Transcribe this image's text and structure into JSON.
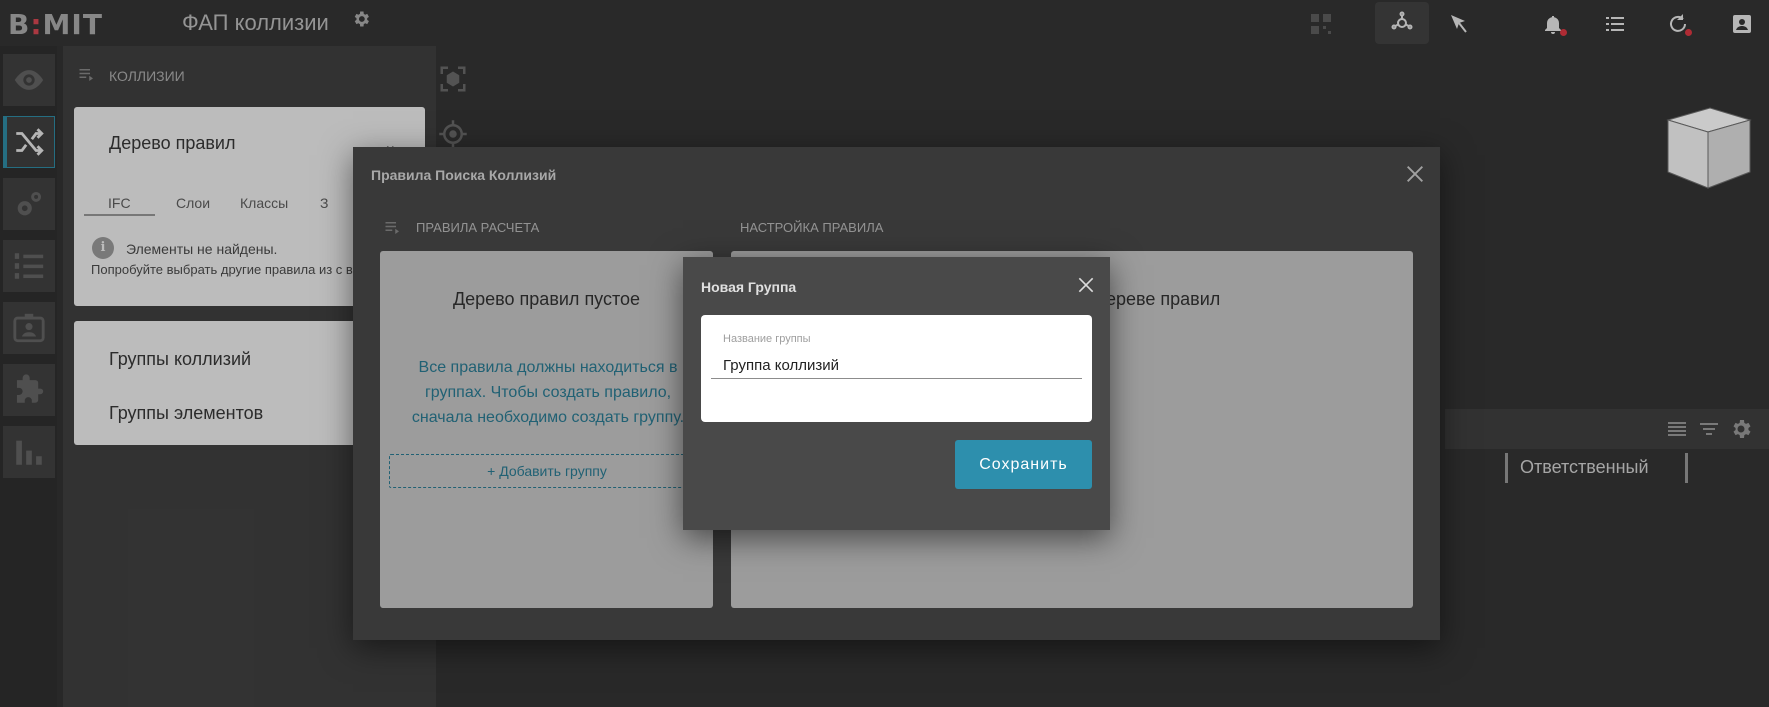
{
  "app": {
    "logo": "BIMIT",
    "project_title": "ФАП коллизии"
  },
  "toolbar": {
    "icons": [
      "qr-icon",
      "model-tree-icon",
      "navigate-icon",
      "bell-icon",
      "list-icon",
      "history-icon",
      "user-icon"
    ]
  },
  "rail": {
    "items": [
      "eye-icon",
      "shuffle-icon",
      "gears-icon",
      "numbered-list-icon",
      "id-card-icon",
      "puzzle-icon",
      "bar-chart-icon"
    ]
  },
  "left_panel": {
    "header": "КОЛЛИЗИИ",
    "rules_card": {
      "title": "Дерево правил",
      "tabs": [
        "IFC",
        "Слои",
        "Классы",
        "З"
      ],
      "info_title": "Элементы не найдены.",
      "info_text": "Попробуйте выбрать другие правила из с выше"
    },
    "groups_card": {
      "collision_groups": "Группы коллизий",
      "element_groups": "Группы элементов"
    }
  },
  "viewport": {
    "table_column": "Ответственный"
  },
  "rules_dialog": {
    "title": "Правила Поиска Коллизий",
    "section_left": "ПРАВИЛА РАСЧЕТА",
    "section_right": "НАСТРОЙКА ПРАВИЛА",
    "left_title": "Дерево правил пустое",
    "left_message": "Все правила должны находиться в группах. Чтобы создать правило, сначала необходимо создать группу.",
    "add_group": "+ Добавить группу",
    "right_title_fragment": "ереве правил"
  },
  "new_group_dialog": {
    "title": "Новая Группа",
    "field_label": "Название группы",
    "field_value": "Группа коллизий",
    "save_label": "Сохранить"
  },
  "colors": {
    "accent": "#2d8fad",
    "link": "#2b7d95",
    "notification": "#c8323c"
  }
}
